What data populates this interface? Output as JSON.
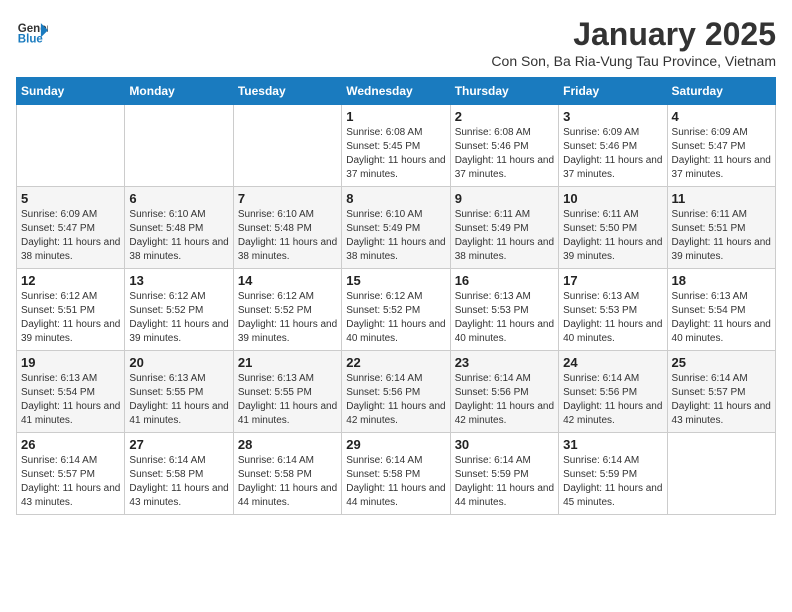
{
  "logo": {
    "general": "General",
    "blue": "Blue"
  },
  "title": "January 2025",
  "subtitle": "Con Son, Ba Ria-Vung Tau Province, Vietnam",
  "days_of_week": [
    "Sunday",
    "Monday",
    "Tuesday",
    "Wednesday",
    "Thursday",
    "Friday",
    "Saturday"
  ],
  "weeks": [
    [
      {
        "day": "",
        "info": ""
      },
      {
        "day": "",
        "info": ""
      },
      {
        "day": "",
        "info": ""
      },
      {
        "day": "1",
        "info": "Sunrise: 6:08 AM\nSunset: 5:45 PM\nDaylight: 11 hours and 37 minutes."
      },
      {
        "day": "2",
        "info": "Sunrise: 6:08 AM\nSunset: 5:46 PM\nDaylight: 11 hours and 37 minutes."
      },
      {
        "day": "3",
        "info": "Sunrise: 6:09 AM\nSunset: 5:46 PM\nDaylight: 11 hours and 37 minutes."
      },
      {
        "day": "4",
        "info": "Sunrise: 6:09 AM\nSunset: 5:47 PM\nDaylight: 11 hours and 37 minutes."
      }
    ],
    [
      {
        "day": "5",
        "info": "Sunrise: 6:09 AM\nSunset: 5:47 PM\nDaylight: 11 hours and 38 minutes."
      },
      {
        "day": "6",
        "info": "Sunrise: 6:10 AM\nSunset: 5:48 PM\nDaylight: 11 hours and 38 minutes."
      },
      {
        "day": "7",
        "info": "Sunrise: 6:10 AM\nSunset: 5:48 PM\nDaylight: 11 hours and 38 minutes."
      },
      {
        "day": "8",
        "info": "Sunrise: 6:10 AM\nSunset: 5:49 PM\nDaylight: 11 hours and 38 minutes."
      },
      {
        "day": "9",
        "info": "Sunrise: 6:11 AM\nSunset: 5:49 PM\nDaylight: 11 hours and 38 minutes."
      },
      {
        "day": "10",
        "info": "Sunrise: 6:11 AM\nSunset: 5:50 PM\nDaylight: 11 hours and 39 minutes."
      },
      {
        "day": "11",
        "info": "Sunrise: 6:11 AM\nSunset: 5:51 PM\nDaylight: 11 hours and 39 minutes."
      }
    ],
    [
      {
        "day": "12",
        "info": "Sunrise: 6:12 AM\nSunset: 5:51 PM\nDaylight: 11 hours and 39 minutes."
      },
      {
        "day": "13",
        "info": "Sunrise: 6:12 AM\nSunset: 5:52 PM\nDaylight: 11 hours and 39 minutes."
      },
      {
        "day": "14",
        "info": "Sunrise: 6:12 AM\nSunset: 5:52 PM\nDaylight: 11 hours and 39 minutes."
      },
      {
        "day": "15",
        "info": "Sunrise: 6:12 AM\nSunset: 5:52 PM\nDaylight: 11 hours and 40 minutes."
      },
      {
        "day": "16",
        "info": "Sunrise: 6:13 AM\nSunset: 5:53 PM\nDaylight: 11 hours and 40 minutes."
      },
      {
        "day": "17",
        "info": "Sunrise: 6:13 AM\nSunset: 5:53 PM\nDaylight: 11 hours and 40 minutes."
      },
      {
        "day": "18",
        "info": "Sunrise: 6:13 AM\nSunset: 5:54 PM\nDaylight: 11 hours and 40 minutes."
      }
    ],
    [
      {
        "day": "19",
        "info": "Sunrise: 6:13 AM\nSunset: 5:54 PM\nDaylight: 11 hours and 41 minutes."
      },
      {
        "day": "20",
        "info": "Sunrise: 6:13 AM\nSunset: 5:55 PM\nDaylight: 11 hours and 41 minutes."
      },
      {
        "day": "21",
        "info": "Sunrise: 6:13 AM\nSunset: 5:55 PM\nDaylight: 11 hours and 41 minutes."
      },
      {
        "day": "22",
        "info": "Sunrise: 6:14 AM\nSunset: 5:56 PM\nDaylight: 11 hours and 42 minutes."
      },
      {
        "day": "23",
        "info": "Sunrise: 6:14 AM\nSunset: 5:56 PM\nDaylight: 11 hours and 42 minutes."
      },
      {
        "day": "24",
        "info": "Sunrise: 6:14 AM\nSunset: 5:56 PM\nDaylight: 11 hours and 42 minutes."
      },
      {
        "day": "25",
        "info": "Sunrise: 6:14 AM\nSunset: 5:57 PM\nDaylight: 11 hours and 43 minutes."
      }
    ],
    [
      {
        "day": "26",
        "info": "Sunrise: 6:14 AM\nSunset: 5:57 PM\nDaylight: 11 hours and 43 minutes."
      },
      {
        "day": "27",
        "info": "Sunrise: 6:14 AM\nSunset: 5:58 PM\nDaylight: 11 hours and 43 minutes."
      },
      {
        "day": "28",
        "info": "Sunrise: 6:14 AM\nSunset: 5:58 PM\nDaylight: 11 hours and 44 minutes."
      },
      {
        "day": "29",
        "info": "Sunrise: 6:14 AM\nSunset: 5:58 PM\nDaylight: 11 hours and 44 minutes."
      },
      {
        "day": "30",
        "info": "Sunrise: 6:14 AM\nSunset: 5:59 PM\nDaylight: 11 hours and 44 minutes."
      },
      {
        "day": "31",
        "info": "Sunrise: 6:14 AM\nSunset: 5:59 PM\nDaylight: 11 hours and 45 minutes."
      },
      {
        "day": "",
        "info": ""
      }
    ]
  ]
}
